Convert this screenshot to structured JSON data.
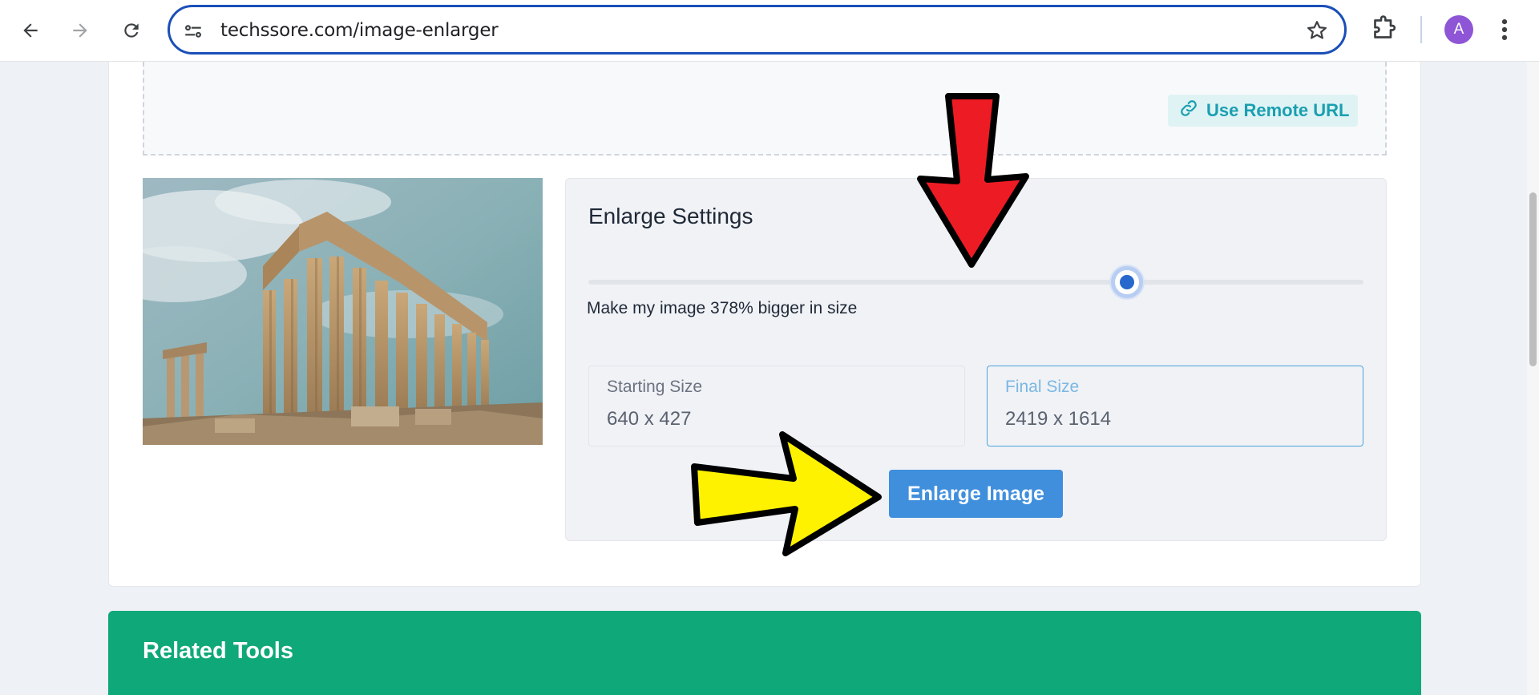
{
  "browser": {
    "url": "techssore.com/image-enlarger",
    "profile_initial": "A",
    "icons": [
      "back-arrow-icon",
      "forward-arrow-icon",
      "reload-icon",
      "site-settings-icon",
      "bookmark-star-icon",
      "extensions-icon",
      "menu-dots-icon"
    ]
  },
  "upload": {
    "remote_url_label": "Use Remote URL"
  },
  "settings": {
    "title": "Enlarge Settings",
    "scale_percent": 378,
    "scale_text": "Make my image 378% bigger in size",
    "starting_size_label": "Starting Size",
    "starting_size_value": "640 x 427",
    "final_size_label": "Final Size",
    "final_size_value": "2419 x 1614",
    "enlarge_button_label": "Enlarge Image"
  },
  "related": {
    "title": "Related Tools"
  },
  "colors": {
    "accent": "#3f8fdd",
    "related_bg": "#0fa878",
    "remote_url_text": "#1a9fb0",
    "annotation_red": "#ed1c24",
    "annotation_yellow": "#fff200"
  }
}
